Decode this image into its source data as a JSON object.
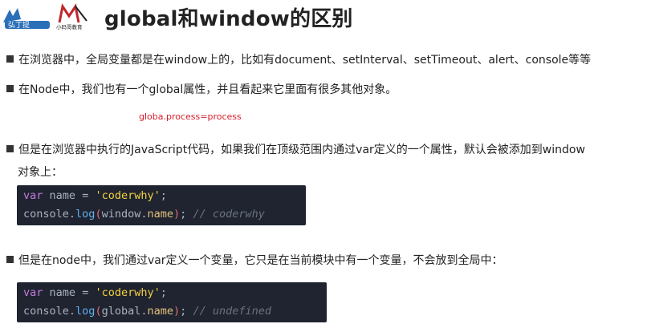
{
  "header": {
    "title": "global和window的区别",
    "logo_left_text": "弘丁提",
    "logo_right_text": "小码哥教育"
  },
  "bullets": [
    {
      "text": "在浏览器中，全局变量都是在window上的，比如有document、setInterval、setTimeout、alert、console等等"
    },
    {
      "text": "在Node中，我们也有一个global属性，并且看起来它里面有很多其他对象。"
    },
    {
      "text": "但是在浏览器中执行的JavaScript代码，如果我们在顶级范围内通过var定义的一个属性，默认会被添加到window",
      "continuation": "对象上："
    },
    {
      "text": "但是在node中，我们通过var定义一个变量，它只是在当前模块中有一个变量，不会放到全局中："
    }
  ],
  "note": "globa.process=process",
  "code1": {
    "line1": {
      "kw": "var",
      "name": "name",
      "eq": "=",
      "str": "'coderwhy'",
      "end": ";"
    },
    "line2": {
      "obj": "console",
      "dot": ".",
      "fn": "log",
      "open": "(",
      "arg": "window",
      "dot2": ".",
      "prop": "name",
      "close": ")",
      "end": ";",
      "comment": "// coderwhy"
    }
  },
  "code2": {
    "line1": {
      "kw": "var",
      "name": "name",
      "eq": "=",
      "str": "'coderwhy'",
      "end": ";"
    },
    "line2": {
      "obj": "console",
      "dot": ".",
      "fn": "log",
      "open": "(",
      "arg": "global",
      "dot2": ".",
      "prop": "name",
      "close": ")",
      "end": ";",
      "comment": "// undefined"
    }
  }
}
